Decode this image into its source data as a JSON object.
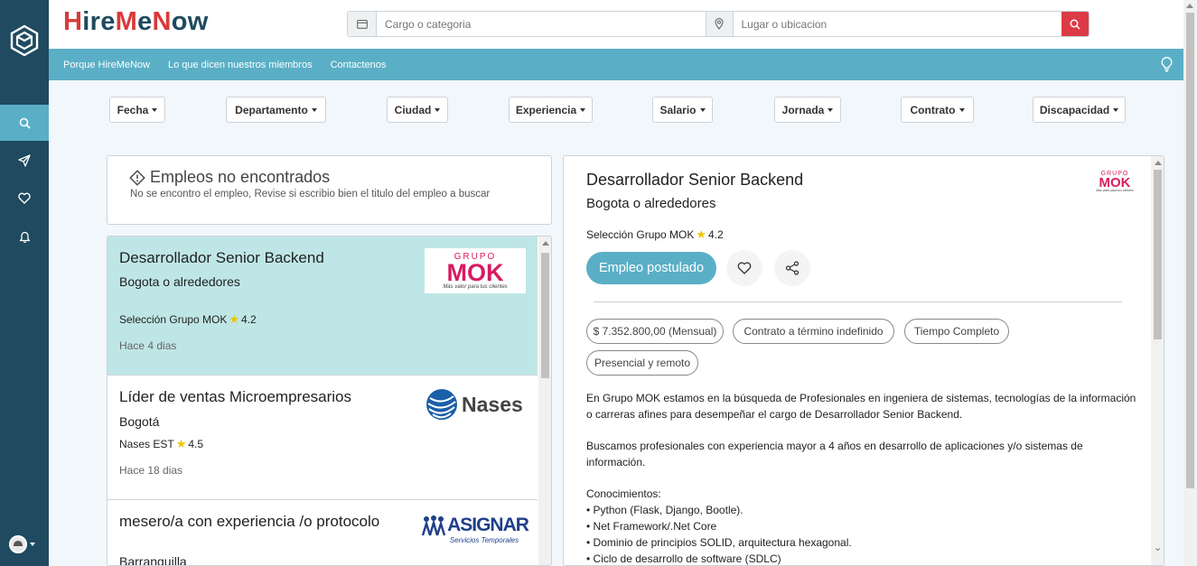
{
  "brand": {
    "part1": "H",
    "part2": "ire",
    "part3": "M",
    "part4": "e",
    "part5": "N",
    "part6": "ow"
  },
  "search": {
    "job_placeholder": "Cargo o categoria",
    "location_placeholder": "Lugar o ubicacion"
  },
  "nav": {
    "items": [
      "Porque HireMeNow",
      "Lo que dicen nuestros miembros",
      "Contactenos"
    ]
  },
  "filters": [
    "Fecha",
    "Departamento",
    "Ciudad",
    "Experiencia",
    "Salario",
    "Jornada",
    "Contrato",
    "Discapacidad"
  ],
  "not_found": {
    "title": "Empleos no encontrados",
    "subtitle": "No se encontro el empleo, Revise si escribio bien el titulo del empleo a buscar"
  },
  "jobs": [
    {
      "title": "Desarrollador Senior Backend",
      "location": "Bogota o alrededores",
      "company": "Selección Grupo MOK",
      "rating": "4.2",
      "ago": "Hace 4 dias",
      "logo_text": [
        "GRUPO",
        "MOK",
        "Más valor para tus clientes"
      ]
    },
    {
      "title": "Líder de ventas Microempresarios",
      "location": "Bogotá",
      "company": "Nases EST",
      "rating": "4.5",
      "ago": "Hace 18 dias",
      "logo_text": [
        "Nases"
      ]
    },
    {
      "title": "mesero/a con experiencia /o protocolo",
      "location": "Barranquilla",
      "logo_text": [
        "ASIGNAR",
        "Servicios Temporales"
      ]
    }
  ],
  "detail": {
    "title": "Desarrollador Senior Backend",
    "location": "Bogota o alrededores",
    "company": "Selección Grupo MOK",
    "rating": "4.2",
    "apply_label": "Empleo postulado",
    "chips": [
      "$ 7.352.800,00 (Mensual)",
      "Contrato a término indefinido",
      "Tiempo Completo",
      "Presencial y remoto"
    ],
    "desc_1": "En Grupo MOK estamos en la búsqueda de Profesionales en ingeniera de sistemas, tecnologías de la información o carreras afines para desempeñar el cargo de Desarrollador Senior Backend.",
    "desc_2": "Buscamos profesionales con experiencia mayor a 4 años en desarrollo de aplicaciones y/o sistemas de información.",
    "desc_3": "Conocimientos:",
    "bullets": [
      "• Python (Flask, Django, Bootle).",
      "• Net Framework/.Net Core",
      "• Dominio de principios SOLID, arquitectura hexagonal.",
      "• Ciclo de desarrollo de software (SDLC)"
    ]
  },
  "colors": {
    "sidebar": "#1f4a5f",
    "accent": "#5aafc6",
    "brand_red": "#d83a3a",
    "search_button": "#dc3a45",
    "selected_card": "#bfe6e6"
  },
  "icons": [
    "logo-hexagon-icon",
    "search-icon",
    "send-icon",
    "heart-icon",
    "bell-icon",
    "calendar-icon",
    "location-pin-icon",
    "lightbulb-icon",
    "share-icon",
    "warning-icon"
  ]
}
